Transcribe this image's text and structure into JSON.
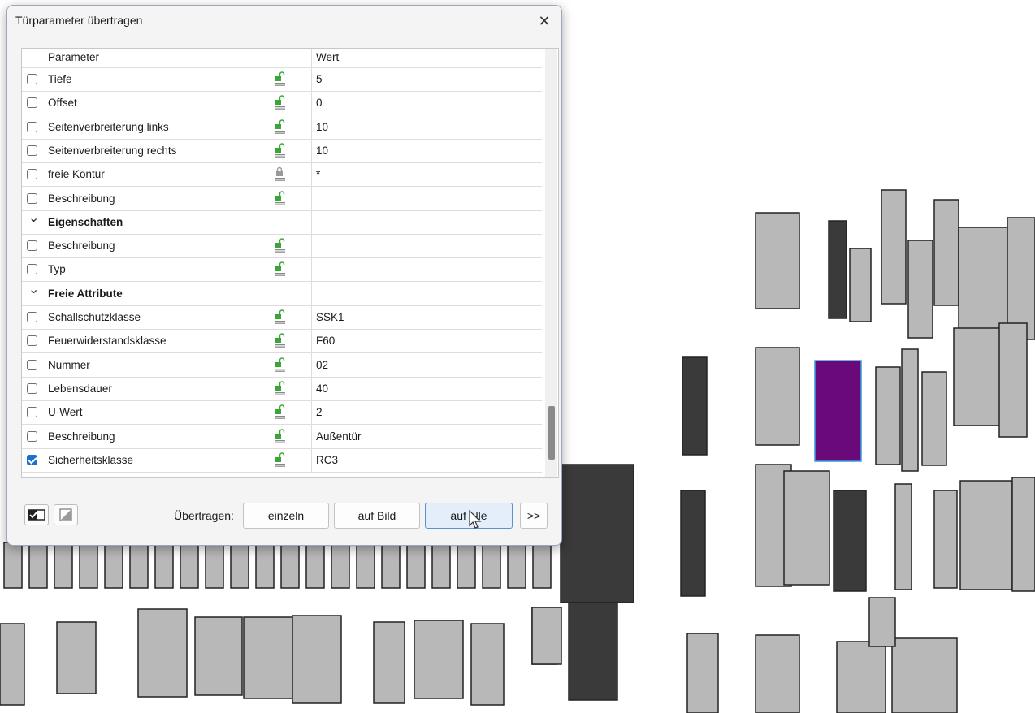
{
  "dialog": {
    "title": "Türparameter übertragen",
    "close_glyph": "✕",
    "columns": {
      "parameter": "Parameter",
      "value": "Wert"
    },
    "rows": [
      {
        "type": "param",
        "name": "Tiefe",
        "value": "5",
        "lock": "unlocked",
        "checked": false
      },
      {
        "type": "param",
        "name": "Offset",
        "value": "0",
        "lock": "unlocked",
        "checked": false
      },
      {
        "type": "param",
        "name": "Seitenverbreiterung links",
        "value": "10",
        "lock": "unlocked",
        "checked": false
      },
      {
        "type": "param",
        "name": "Seitenverbreiterung rechts",
        "value": "10",
        "lock": "unlocked",
        "checked": false
      },
      {
        "type": "param",
        "name": "freie Kontur",
        "value": "*",
        "lock": "locked",
        "checked": false
      },
      {
        "type": "param",
        "name": "Beschreibung",
        "value": "",
        "lock": "unlocked",
        "checked": false
      },
      {
        "type": "group",
        "name": "Eigenschaften"
      },
      {
        "type": "param",
        "name": "Beschreibung",
        "value": "",
        "lock": "unlocked",
        "checked": false
      },
      {
        "type": "param",
        "name": "Typ",
        "value": "",
        "lock": "unlocked",
        "checked": false
      },
      {
        "type": "group",
        "name": "Freie Attribute"
      },
      {
        "type": "param",
        "name": "Schallschutzklasse",
        "value": "SSK1",
        "lock": "unlocked",
        "checked": false
      },
      {
        "type": "param",
        "name": "Feuerwiderstandsklasse",
        "value": "F60",
        "lock": "unlocked",
        "checked": false
      },
      {
        "type": "param",
        "name": "Nummer",
        "value": "02",
        "lock": "unlocked",
        "checked": false
      },
      {
        "type": "param",
        "name": "Lebensdauer",
        "value": "40",
        "lock": "unlocked",
        "checked": false
      },
      {
        "type": "param",
        "name": "U-Wert",
        "value": "2",
        "lock": "unlocked",
        "checked": false
      },
      {
        "type": "param",
        "name": "Beschreibung",
        "value": "Außentür",
        "lock": "unlocked",
        "checked": false
      },
      {
        "type": "param",
        "name": "Sicherheitsklasse",
        "value": "RC3",
        "lock": "unlocked",
        "checked": true
      }
    ],
    "footer": {
      "transfer_label": "Übertragen:",
      "buttons": {
        "single": "einzeln",
        "on_image": "auf Bild",
        "all": "auf alle",
        "more": ">>"
      }
    }
  },
  "colors": {
    "accent": "#1e6fd0",
    "lock_green": "#3aa63a",
    "selected_door": "#6a0a7a",
    "selection_outline": "#3a9be0"
  }
}
